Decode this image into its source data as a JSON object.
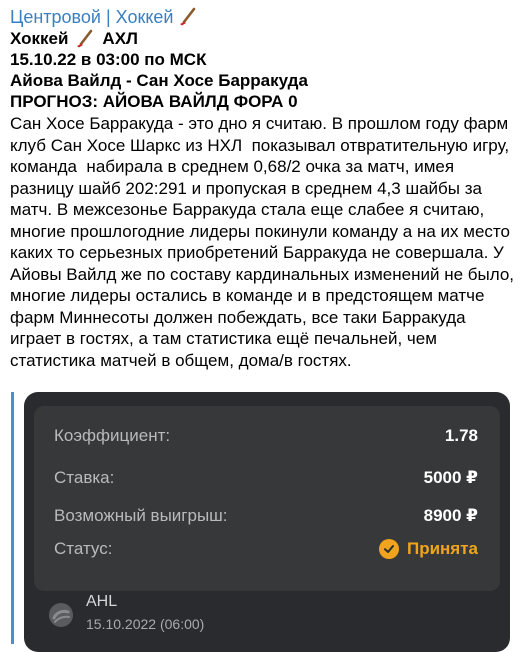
{
  "post": {
    "channel": "Центровой | Хоккей",
    "sport": "Хоккей",
    "league": "АХЛ",
    "datetime": "15.10.22  в 03:00 по МСК",
    "match": "Айова Вайлд - Сан Хосе Барракуда",
    "prediction": "ПРОГНОЗ: АЙОВА ВАЙЛД ФОРА 0",
    "body": "Сан Хосе Барракуда - это дно я считаю. В прошлом году фарм клуб Сан Хосе Шаркс из НХЛ  показывал отвратительную игру, команда  набирала в среднем 0,68/2 очка за матч, имея разницу шайб 202:291 и пропуская в среднем 4,3 шайбы за матч. В межсезонье Барракуда стала еще слабее я считаю, многие прошлогодние лидеры покинули команду а на их место каких то серьезных приобретений Барракуда не совершала. У Айовы Вайлд же по составу кардинальных изменений не было, многие лидеры остались в команде и в предстоящем матче фарм Миннесоты должен побеждать, все таки Барракуда играет в гостях, а там статистика ещё печальней, чем статистика матчей в общем, дома/в гостях."
  },
  "bet": {
    "coef_label": "Коэффициент:",
    "coef_value": "1.78",
    "stake_label": "Ставка:",
    "stake_value": "5000 ₽",
    "win_label": "Возможный выигрыш:",
    "win_value": "8900 ₽",
    "status_label": "Статус:",
    "status_value": "Принята",
    "league": "AHL",
    "date": "15.10.2022 (06:00)"
  },
  "colors": {
    "channel": "#3a7fc0",
    "accent": "#f0a41e",
    "card_bg": "#2a2b2e"
  },
  "icons": [
    "hockey-stick-icon",
    "check-circle-icon",
    "hockey-puck-icon"
  ]
}
